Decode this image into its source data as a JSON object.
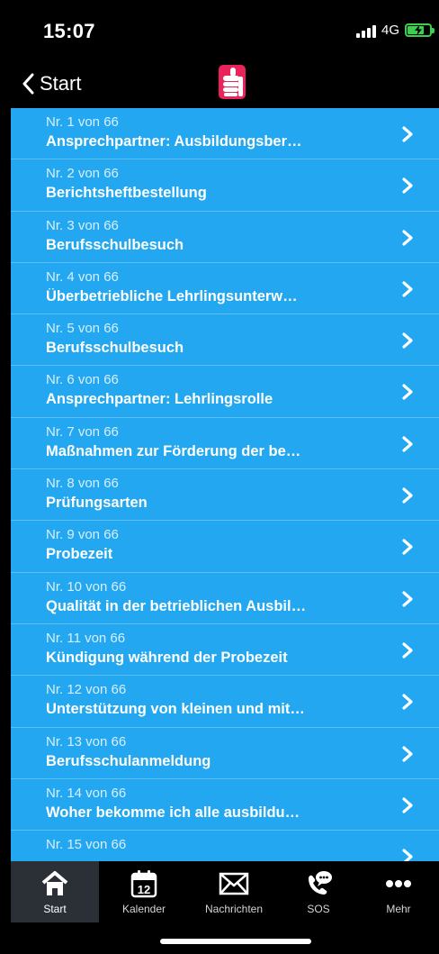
{
  "status_bar": {
    "time": "15:07",
    "network": "4G",
    "signal_icon": "signal-bars-icon",
    "battery_icon": "battery-charging-icon"
  },
  "nav": {
    "back_label": "Start",
    "back_icon": "chevron-left-icon",
    "logo_icon": "thumbs-up-logo-icon"
  },
  "colors": {
    "list_background": "#22a7f0",
    "logo": "#e8245a",
    "tab_active_background": "#2b2f36"
  },
  "list": {
    "items": [
      {
        "number": "Nr. 1 von 66",
        "title": "Ansprechpartner: Ausbildungsber…"
      },
      {
        "number": "Nr. 2 von 66",
        "title": "Berichtsheftbestellung"
      },
      {
        "number": "Nr. 3 von 66",
        "title": "Berufsschulbesuch"
      },
      {
        "number": "Nr. 4 von 66",
        "title": "Überbetriebliche Lehrlingsunterw…"
      },
      {
        "number": "Nr. 5 von 66",
        "title": "Berufsschulbesuch"
      },
      {
        "number": "Nr. 6 von 66",
        "title": "Ansprechpartner: Lehrlingsrolle"
      },
      {
        "number": "Nr. 7 von 66",
        "title": "Maßnahmen zur Förderung der be…"
      },
      {
        "number": "Nr. 8 von 66",
        "title": "Prüfungsarten"
      },
      {
        "number": "Nr. 9 von 66",
        "title": "Probezeit"
      },
      {
        "number": "Nr. 10 von 66",
        "title": "Qualität in der betrieblichen Ausbil…"
      },
      {
        "number": "Nr. 11 von 66",
        "title": "Kündigung während der Probezeit"
      },
      {
        "number": "Nr. 12 von 66",
        "title": "Unterstützung von kleinen und mit…"
      },
      {
        "number": "Nr. 13 von 66",
        "title": "Berufsschulanmeldung"
      },
      {
        "number": "Nr. 14 von 66",
        "title": "Woher bekomme ich alle ausbildu…"
      },
      {
        "number": "Nr. 15 von 66",
        "title": ""
      }
    ]
  },
  "tab_bar": {
    "tabs": [
      {
        "label": "Start",
        "icon": "home-icon",
        "active": true
      },
      {
        "label": "Kalender",
        "icon": "calendar-icon",
        "calendar_day": "12",
        "active": false
      },
      {
        "label": "Nachrichten",
        "icon": "envelope-icon",
        "active": false
      },
      {
        "label": "SOS",
        "icon": "phone-chat-icon",
        "active": false
      },
      {
        "label": "Mehr",
        "icon": "more-dots-icon",
        "active": false
      }
    ]
  }
}
